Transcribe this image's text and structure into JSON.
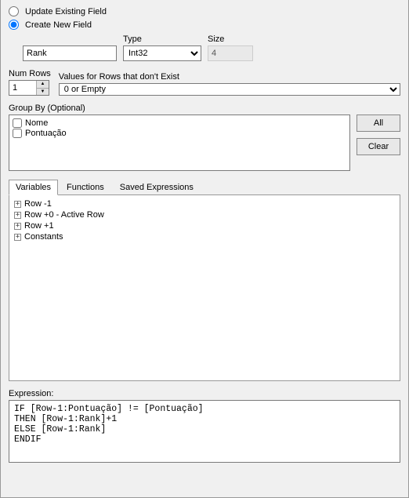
{
  "fieldMode": {
    "updateLabel": "Update Existing Field",
    "createLabel": "Create New  Field"
  },
  "newField": {
    "nameLabel": "",
    "nameValue": "Rank",
    "typeLabel": "Type",
    "typeValue": "Int32",
    "sizeLabel": "Size",
    "sizeValue": "4"
  },
  "numRows": {
    "label": "Num Rows",
    "value": "1"
  },
  "valuesMissing": {
    "label": "Values for Rows that don't Exist",
    "value": "0 or Empty"
  },
  "groupBy": {
    "label": "Group By (Optional)",
    "items": [
      "Nome",
      "Pontuação"
    ]
  },
  "buttons": {
    "all": "All",
    "clear": "Clear"
  },
  "tabs": {
    "variables": "Variables",
    "functions": "Functions",
    "saved": "Saved Expressions"
  },
  "tree": {
    "items": [
      "Row -1",
      "Row +0 - Active Row",
      "Row +1",
      "Constants"
    ]
  },
  "expression": {
    "label": "Expression:",
    "text": "IF [Row-1:Pontuação] != [Pontuação]\nTHEN [Row-1:Rank]+1\nELSE [Row-1:Rank]\nENDIF"
  }
}
